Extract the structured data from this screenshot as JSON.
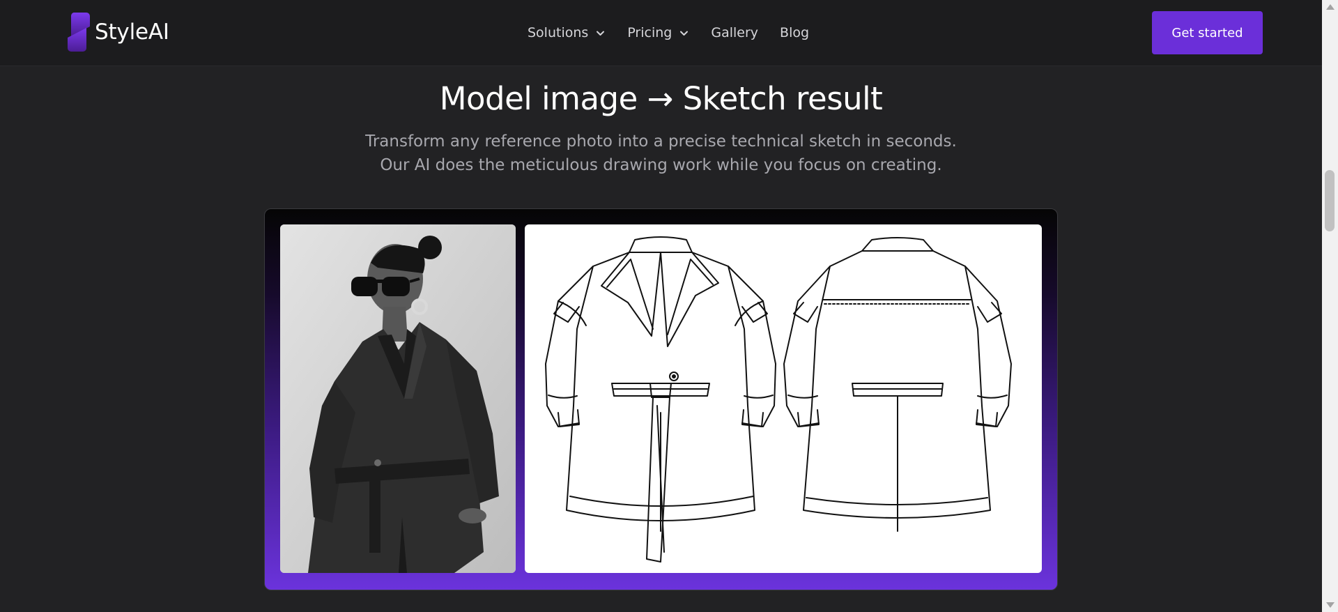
{
  "brand": {
    "name": "StyleAI",
    "logo_color": "#6b2fd9"
  },
  "nav": {
    "items": [
      {
        "label": "Solutions",
        "has_dropdown": true
      },
      {
        "label": "Pricing",
        "has_dropdown": true
      },
      {
        "label": "Gallery",
        "has_dropdown": false
      },
      {
        "label": "Blog",
        "has_dropdown": false
      }
    ],
    "cta_label": "Get started"
  },
  "hero": {
    "title": "Model image → Sketch result",
    "subtitle_line1": "Transform any reference photo into a precise technical sketch in seconds.",
    "subtitle_line2": "Our AI does the meticulous drawing work while you focus on creating."
  },
  "showcase": {
    "model_photo": "black-and-white photo of a model in sunglasses and hoop earrings wearing a belted utility romper",
    "sketch": "technical flat sketch of the belted romper, front and back views"
  },
  "colors": {
    "accent": "#6b2fd9",
    "background": "#222224",
    "navbar": "#1c1c1e",
    "muted_text": "#a8a8ae"
  }
}
